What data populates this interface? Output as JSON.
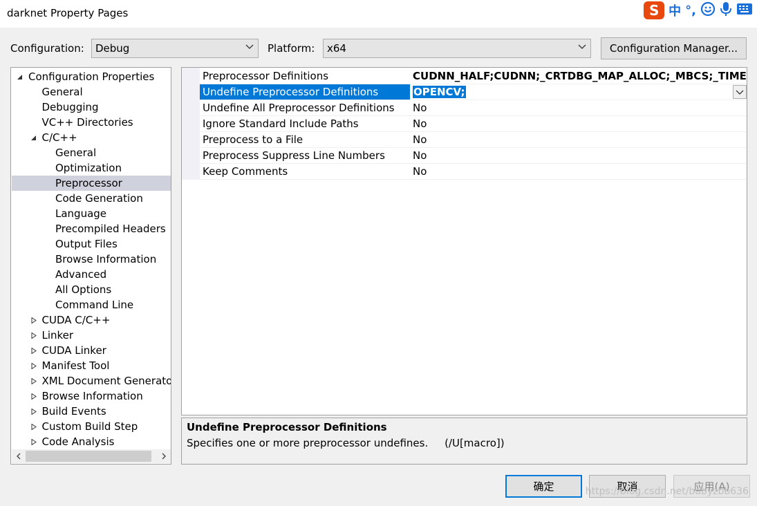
{
  "window": {
    "title": "darknet Property Pages"
  },
  "ime": {
    "logo": "S",
    "lang": "中",
    "punct": "°,",
    "emoji_icon": "smile-icon",
    "mic_icon": "mic-icon",
    "keyboard_icon": "keyboard-icon"
  },
  "config": {
    "configuration_label": "Configuration:",
    "configuration_value": "Debug",
    "platform_label": "Platform:",
    "platform_value": "x64",
    "manager_button": "Configuration Manager..."
  },
  "tree": {
    "items": [
      {
        "label": "Configuration Properties",
        "level": 0,
        "state": "expanded"
      },
      {
        "label": "General",
        "level": 1,
        "state": "leaf"
      },
      {
        "label": "Debugging",
        "level": 1,
        "state": "leaf"
      },
      {
        "label": "VC++ Directories",
        "level": 1,
        "state": "leaf"
      },
      {
        "label": "C/C++",
        "level": 1,
        "state": "expanded"
      },
      {
        "label": "General",
        "level": 2,
        "state": "leaf"
      },
      {
        "label": "Optimization",
        "level": 2,
        "state": "leaf"
      },
      {
        "label": "Preprocessor",
        "level": 2,
        "state": "leaf",
        "selected": true
      },
      {
        "label": "Code Generation",
        "level": 2,
        "state": "leaf"
      },
      {
        "label": "Language",
        "level": 2,
        "state": "leaf"
      },
      {
        "label": "Precompiled Headers",
        "level": 2,
        "state": "leaf"
      },
      {
        "label": "Output Files",
        "level": 2,
        "state": "leaf"
      },
      {
        "label": "Browse Information",
        "level": 2,
        "state": "leaf"
      },
      {
        "label": "Advanced",
        "level": 2,
        "state": "leaf"
      },
      {
        "label": "All Options",
        "level": 2,
        "state": "leaf"
      },
      {
        "label": "Command Line",
        "level": 2,
        "state": "leaf"
      },
      {
        "label": "CUDA C/C++",
        "level": 1,
        "state": "collapsed"
      },
      {
        "label": "Linker",
        "level": 1,
        "state": "collapsed"
      },
      {
        "label": "CUDA Linker",
        "level": 1,
        "state": "collapsed"
      },
      {
        "label": "Manifest Tool",
        "level": 1,
        "state": "collapsed"
      },
      {
        "label": "XML Document Generato",
        "level": 1,
        "state": "collapsed"
      },
      {
        "label": "Browse Information",
        "level": 1,
        "state": "collapsed"
      },
      {
        "label": "Build Events",
        "level": 1,
        "state": "collapsed"
      },
      {
        "label": "Custom Build Step",
        "level": 1,
        "state": "collapsed"
      },
      {
        "label": "Code Analysis",
        "level": 1,
        "state": "collapsed"
      }
    ]
  },
  "properties": {
    "rows": [
      {
        "name": "Preprocessor Definitions",
        "value": "CUDNN_HALF;CUDNN;_CRTDBG_MAP_ALLOC;_MBCS;_TIMESPEC",
        "bold": true
      },
      {
        "name": "Undefine Preprocessor Definitions",
        "value": "OPENCV;",
        "selected": true,
        "bold": true
      },
      {
        "name": "Undefine All Preprocessor Definitions",
        "value": "No"
      },
      {
        "name": "Ignore Standard Include Paths",
        "value": "No"
      },
      {
        "name": "Preprocess to a File",
        "value": "No"
      },
      {
        "name": "Preprocess Suppress Line Numbers",
        "value": "No"
      },
      {
        "name": "Keep Comments",
        "value": "No"
      }
    ]
  },
  "description": {
    "title": "Undefine Preprocessor Definitions",
    "text": "Specifies one or more preprocessor undefines.     (/U[macro])"
  },
  "buttons": {
    "ok": "确定",
    "cancel": "取消",
    "apply": "应用(A)"
  },
  "watermark": "https://blog.csdn.net/babyzbb636"
}
